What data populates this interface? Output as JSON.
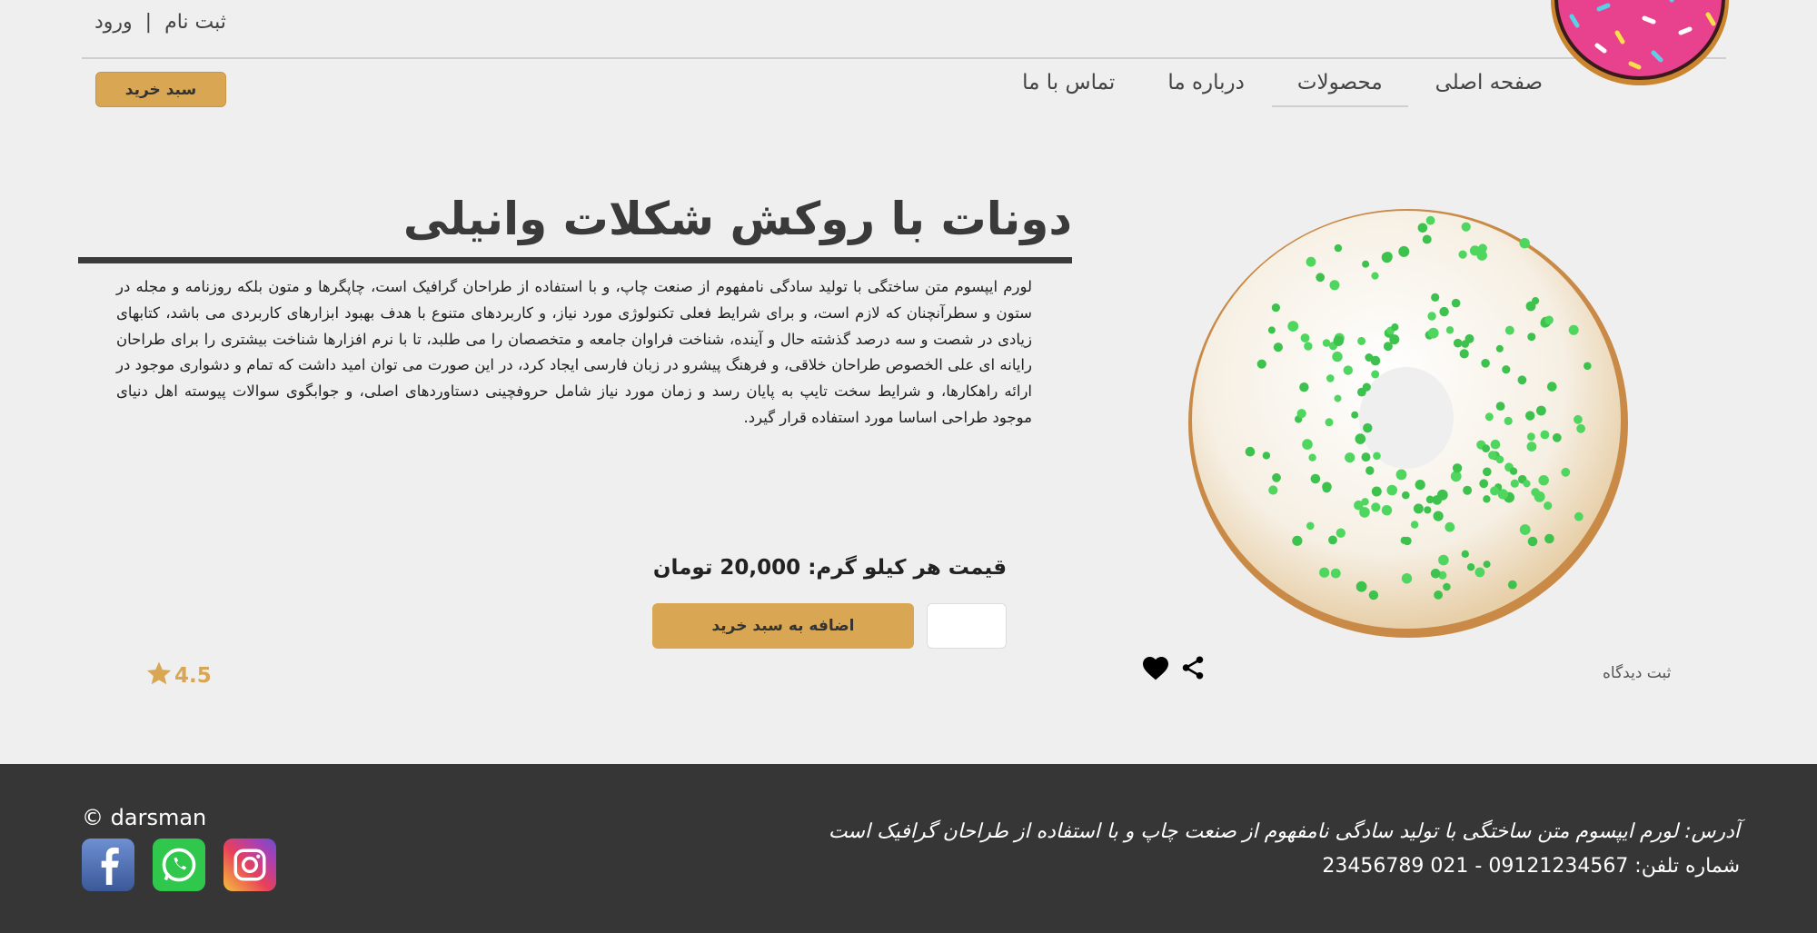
{
  "header": {
    "signup_label": "ثبت نام",
    "separator": "|",
    "login_label": "ورود",
    "cart_label": "سبد خرید"
  },
  "nav": {
    "home": "صفحه اصلی",
    "products": "محصولات",
    "about": "درباره ما",
    "contact": "تماس با ما",
    "active": "products"
  },
  "product": {
    "title": "دونات با روکش شکلات وانیلی",
    "description": "لورم ایپسوم متن ساختگی با تولید سادگی نامفهوم از صنعت چاپ، و با استفاده از طراحان گرافیک است، چاپگرها و متون بلکه روزنامه و مجله در ستون و سطرآنچنان که لازم است، و برای شرایط فعلی تکنولوژی مورد نیاز، و کاربردهای متنوع با هدف بهبود ابزارهای کاربردی می باشد، کتابهای زیادی در شصت و سه درصد گذشته حال و آینده، شناخت فراوان جامعه و متخصصان را می طلبد، تا با نرم افزارها شناخت بیشتری را برای طراحان رایانه ای علی الخصوص طراحان خلاقی، و فرهنگ پیشرو در زبان فارسی ایجاد کرد، در این صورت می توان امید داشت که تمام و دشواری موجود در ارائه راهکارها، و شرایط سخت تایپ به پایان رسد و زمان مورد نیاز شامل حروفچینی دستاوردهای اصلی، و جوابگوی سوالات پیوسته اهل دنیای موجود طراحی اساسا مورد استفاده قرار گیرد.",
    "price_text": "قیمت هر کیلو گرم: 20,000 تومان",
    "quantity_value": "",
    "add_to_cart_label": "اضافه به سبد خرید",
    "rating": "4.5",
    "comment_label": "ثبت دیدگاه"
  },
  "footer": {
    "copyright": "© darsman",
    "address": "آدرس: لورم ایپسوم متن ساختگی با تولید سادگی نامفهوم از صنعت چاپ و با استفاده از طراحان گرافیک است",
    "phone": "شماره تلفن: 09121234567 - 021 23456789",
    "social": [
      "facebook-icon",
      "whatsapp-icon",
      "instagram-icon"
    ]
  },
  "colors": {
    "accent": "#d9a653",
    "background": "#efefef",
    "footer": "#363636",
    "title_bar": "#3b3b3b"
  }
}
